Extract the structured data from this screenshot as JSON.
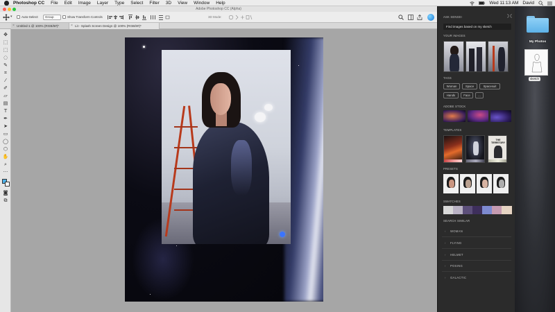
{
  "menubar": {
    "items": [
      "Photoshop CC",
      "File",
      "Edit",
      "Image",
      "Layer",
      "Type",
      "Select",
      "Filter",
      "3D",
      "View",
      "Window",
      "Help"
    ],
    "clock": "Wed 11:13 AM",
    "user": "David"
  },
  "window": {
    "title": "Adobe Photoshop CC (Alpha)"
  },
  "options": {
    "auto_select_label": "Auto-Select:",
    "auto_select_value": "Group",
    "transform_label": "Show Transform Controls",
    "mode_label": "3D Mode:"
  },
  "tabs": [
    {
      "label": "Untitled-1 @ 100% (RGB/8#)*"
    },
    {
      "label": "Lit - Splash Screen Design @ 100% (RGB/8#)*"
    }
  ],
  "panel": {
    "ask_title": "ASK SENSEI",
    "prompt": "Find images based on my sketch",
    "your_images_title": "YOUR IMAGES",
    "tags_title": "TAGS",
    "tags": [
      "Woman",
      "Space",
      "Spacesuit",
      "Hands",
      "Face",
      "..."
    ],
    "stock_title": "ADOBE STOCK",
    "templates_title": "TEMPLATES",
    "presets_title": "PRESETS",
    "swatches_title": "SWATCHES",
    "search_title": "SEARCH SIMILAR",
    "search_items": [
      "WOMAN",
      "FLYING",
      "HELMET",
      "POSING",
      "GALACTIC"
    ],
    "template_text": "THE TERRITORY",
    "swatch_colors": [
      "#d9d9d9",
      "#b9b2c4",
      "#5c4f7a",
      "#3e2f5c",
      "#7d8ad0",
      "#c69bb1",
      "#e6d4c3"
    ]
  },
  "desktop": {
    "folder_label": "My Photos",
    "file_label": "sketch"
  },
  "icons": {
    "search": "search-icon",
    "share": "share-icon",
    "workspace": "workspace-icon",
    "profile": "profile-icon"
  }
}
